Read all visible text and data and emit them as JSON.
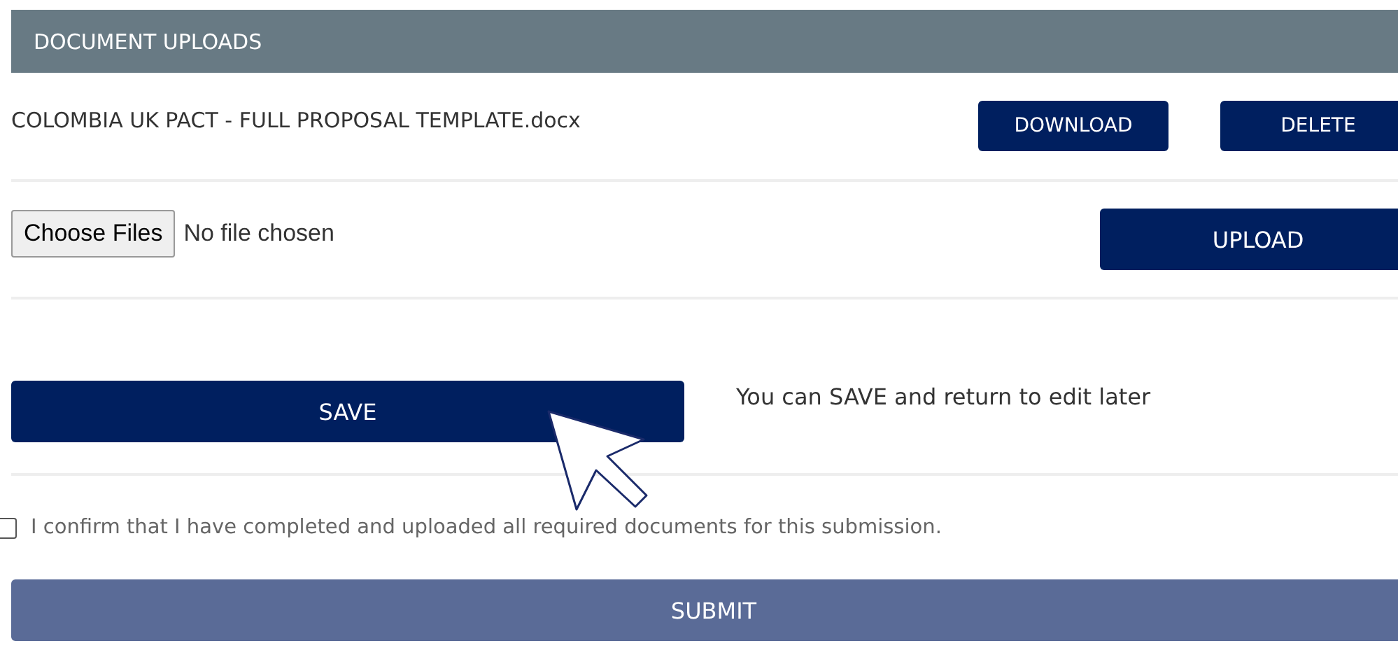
{
  "section": {
    "title": "DOCUMENT UPLOADS"
  },
  "files": [
    {
      "name": "COLOMBIA UK PACT - FULL PROPOSAL TEMPLATE.docx",
      "actions": [
        "DOWNLOAD",
        "DELETE"
      ]
    }
  ],
  "file_picker": {
    "button": "Choose Files",
    "status": "No file chosen",
    "upload": "UPLOAD"
  },
  "save": {
    "label": "SAVE",
    "hint": "You can SAVE and return to edit later"
  },
  "confirm": {
    "label": "I confirm that I have completed and uploaded all required documents for this submission.",
    "checked": false
  },
  "submit": {
    "label": "SUBMIT",
    "disabled": true
  }
}
